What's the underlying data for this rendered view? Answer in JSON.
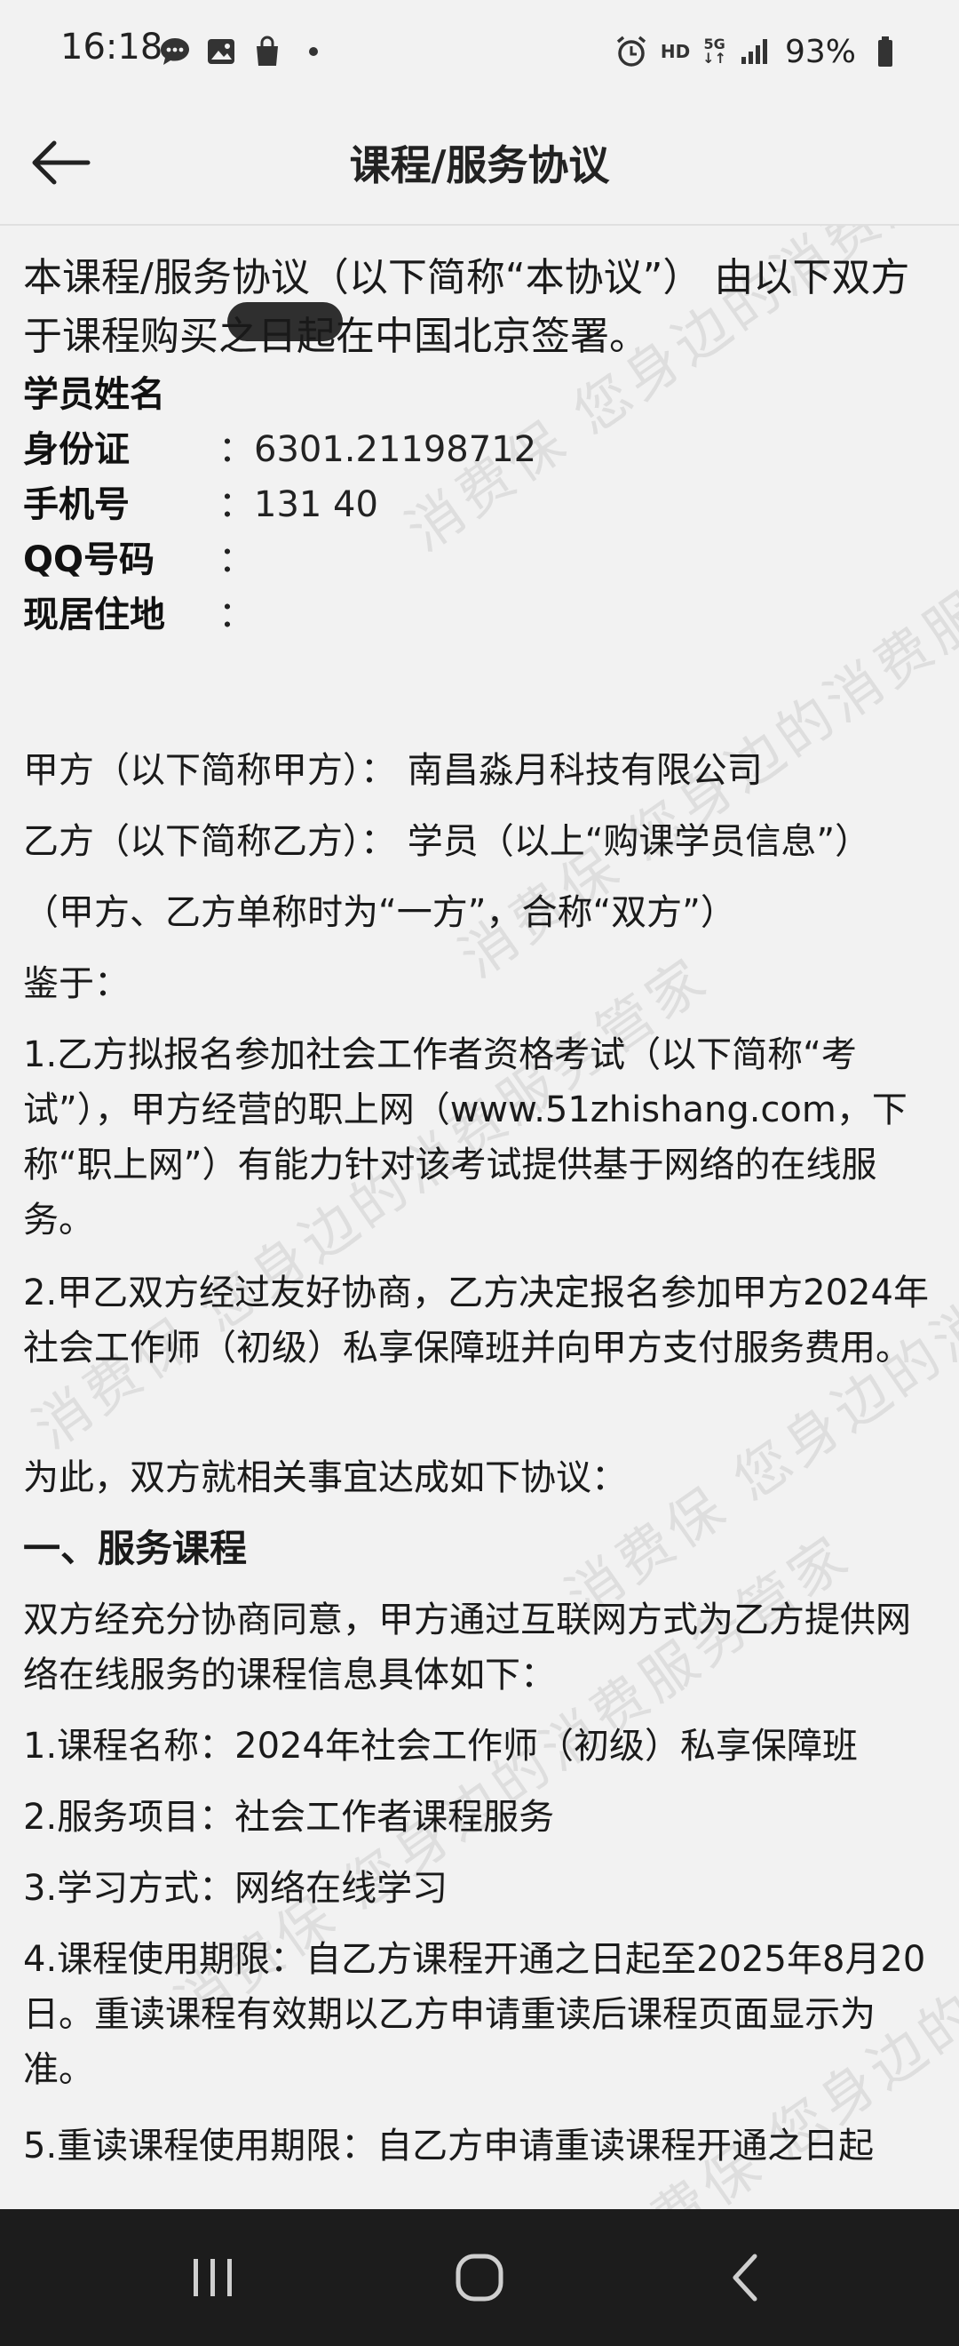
{
  "status_bar": {
    "time": "16:18",
    "left_icons": [
      "message-icon",
      "image-icon",
      "shopping-bag-icon",
      "dot-icon"
    ],
    "hd": "HD",
    "network": "5G",
    "battery": "93%"
  },
  "nav": {
    "title": "课程/服务协议"
  },
  "agreement": {
    "intro": "本课程/服务协议（以下简称“本协议”） 由以下双方于课程购买之日起在中国北京签署。",
    "fields": [
      {
        "label": "学员姓名",
        "value": ""
      },
      {
        "label": "身份证",
        "value": "：6301.21198712"
      },
      {
        "label": "手机号",
        "value": "：131        40"
      },
      {
        "label": "QQ号码",
        "value": "："
      },
      {
        "label": "现居住地",
        "value": "："
      }
    ],
    "party_a": "甲方（以下简称甲方）：  南昌淼月科技有限公司",
    "party_b": "乙方（以下简称乙方）：  学员（以上“购课学员信息”）",
    "parties_note": "（甲方、乙方单称时为“一方”，合称“双方”）",
    "whereas": "鉴于：",
    "clause_1": "1.乙方拟报名参加社会工作者资格考试（以下简称“考试”），甲方经营的职上网（www.51zhishang.com，下称“职上网”）有能力针对该考试提供基于网络的在线服务。",
    "clause_2": "2.甲乙双方经过友好协商，乙方决定报名参加甲方2024年社会工作师（初级）私享保障班并向甲方支付服务费用。",
    "therefore": "为此，双方就相关事宜达成如下协议：",
    "section_1_title": "一、服务课程",
    "section_1_intro": "双方经充分协商同意，甲方通过互联网方式为乙方提供网络在线服务的课程信息具体如下：",
    "item_1": "1.课程名称：2024年社会工作师（初级）私享保障班",
    "item_2": "2.服务项目：社会工作者课程服务",
    "item_3": "3.学习方式：网络在线学习",
    "item_4": "4.课程使用期限：自乙方课程开通之日起至2025年8月20日。重读课程有效期以乙方申请重读后课程页面显示为准。",
    "item_5": "5.重读课程使用期限：自乙方申请重读课程开通之日起"
  },
  "watermark_text": "消费保 您身边的消费服务管家",
  "bottom_nav": {
    "buttons": [
      "recents-icon",
      "home-icon",
      "back-icon"
    ]
  }
}
